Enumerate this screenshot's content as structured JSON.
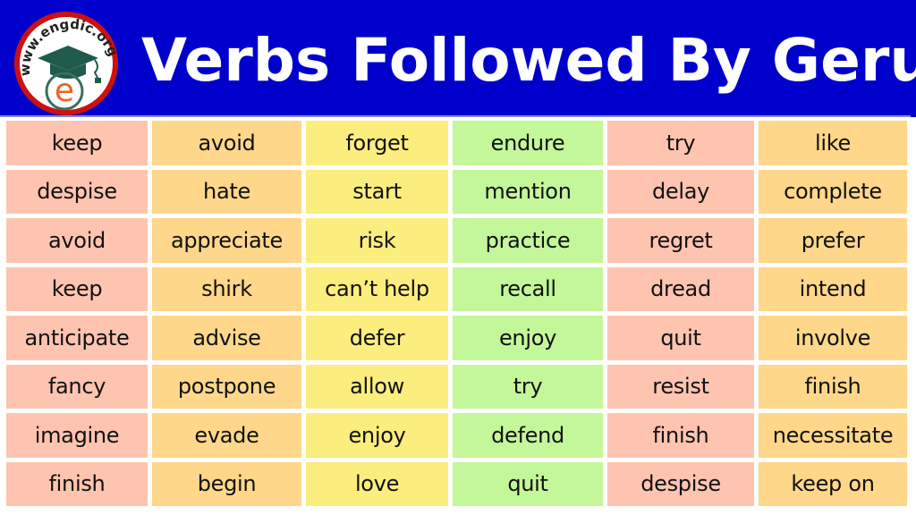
{
  "header": {
    "title": "Verbs Followed By Gerund",
    "logo": {
      "site_text": "www.engdic.org",
      "letter": "e",
      "icon": "graduation-cap-icon"
    },
    "background_color": "#0000cc"
  },
  "columns": [
    {
      "color": "#ffc4af",
      "color_name": "salmon",
      "words": [
        "keep",
        "despise",
        "avoid",
        "keep",
        "anticipate",
        "fancy",
        "imagine",
        "finish"
      ]
    },
    {
      "color": "#ffd78a",
      "color_name": "orange",
      "words": [
        "avoid",
        "hate",
        "appreciate",
        "shirk",
        "advise",
        "postpone",
        "evade",
        "begin"
      ]
    },
    {
      "color": "#fbed7e",
      "color_name": "yellow",
      "words": [
        "forget",
        "start",
        "risk",
        "can’t help",
        "defer",
        "allow",
        "enjoy",
        "love"
      ]
    },
    {
      "color": "#c3f79a",
      "color_name": "green",
      "words": [
        "endure",
        "mention",
        "practice",
        "recall",
        "enjoy",
        "try",
        "defend",
        "quit"
      ]
    },
    {
      "color": "#ffc4af",
      "color_name": "salmon",
      "words": [
        "try",
        "delay",
        "regret",
        "dread",
        "quit",
        "resist",
        "finish",
        "despise"
      ]
    },
    {
      "color": "#ffd78a",
      "color_name": "orange",
      "words": [
        "like",
        "complete",
        "prefer",
        "intend",
        "involve",
        "finish",
        "necessitate",
        "keep on"
      ]
    }
  ]
}
